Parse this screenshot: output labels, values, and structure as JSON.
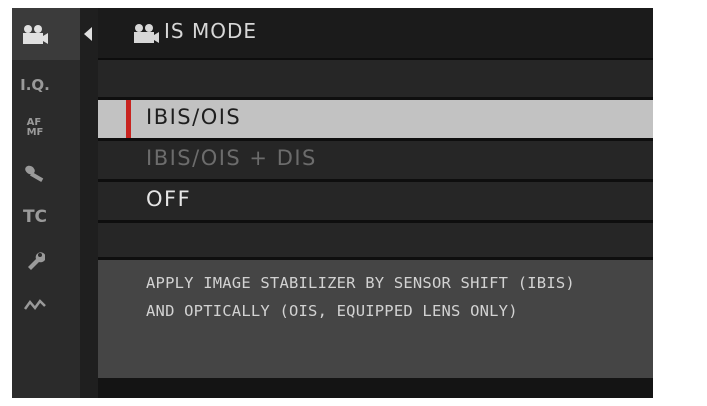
{
  "header": {
    "title": "IS MODE",
    "title_icon": "movie-camera-icon"
  },
  "sidebar": {
    "items": [
      {
        "icon": "movie-camera-icon",
        "label": "",
        "active": true
      },
      {
        "icon": "image-quality-icon",
        "label": "I.Q."
      },
      {
        "icon": "af-mf-icon",
        "label": "AF\nMF"
      },
      {
        "icon": "microphone-icon",
        "label": ""
      },
      {
        "icon": "timecode-icon",
        "label": "TC"
      },
      {
        "icon": "wrench-icon",
        "label": ""
      },
      {
        "icon": "connection-icon",
        "label": ""
      }
    ]
  },
  "menu": {
    "options": [
      {
        "label": "IBIS/OIS",
        "state": "selected"
      },
      {
        "label": "IBIS/OIS + DIS",
        "state": "disabled"
      },
      {
        "label": "OFF",
        "state": "normal"
      }
    ]
  },
  "description": {
    "line1": "APPLY IMAGE STABILIZER BY SENSOR SHIFT (IBIS)",
    "line2": "AND OPTICALLY (OIS, EQUIPPED LENS ONLY)"
  },
  "colors": {
    "selected_marker": "#c8231f",
    "selected_row": "#c2c2c2",
    "background": "#141414"
  }
}
